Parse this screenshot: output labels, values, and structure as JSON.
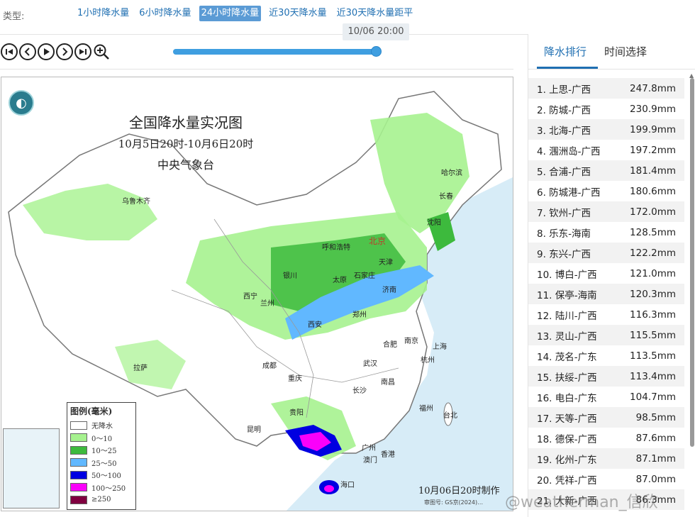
{
  "type_bar": {
    "label": "类型:",
    "tabs": [
      {
        "label": "1小时降水量",
        "active": false
      },
      {
        "label": "6小时降水量",
        "active": false
      },
      {
        "label": "24小时降水量",
        "active": true
      },
      {
        "label": "近30天降水量",
        "active": false
      },
      {
        "label": "近30天降水量距平",
        "active": false
      }
    ]
  },
  "player": {
    "time_tip": "10/06 20:00",
    "progress": 0.99,
    "buttons": [
      "first-icon",
      "prev-icon",
      "play-icon",
      "next-icon",
      "last-icon",
      "zoom-in-icon"
    ]
  },
  "map": {
    "title": "全国降水量实况图",
    "period": "10月5日20时-10月6日20时",
    "agency": "中央气象台",
    "make_note": "10月06日20时制作",
    "review_no": "审图号: GS京(2024)…",
    "watermark": "@weatherman_信欣",
    "cities": {
      "urumqi": "乌鲁木齐",
      "harbin": "哈尔滨",
      "changchun": "长春",
      "shenyang": "沈阳",
      "beijing": "北京",
      "tianjin": "天津",
      "hohhot": "呼和浩特",
      "shijiazhuang": "石家庄",
      "taiyuan": "太原",
      "jinan": "济南",
      "yinchuan": "银川",
      "xining": "西宁",
      "lanzhou": "兰州",
      "zhengzhou": "郑州",
      "xian": "西安",
      "hefei": "合肥",
      "nanjing": "南京",
      "shanghai": "上海",
      "hangzhou": "杭州",
      "wuhan": "武汉",
      "chengdu": "成都",
      "chongqing": "重庆",
      "lhasa": "拉萨",
      "changsha": "长沙",
      "nanchang": "南昌",
      "fuzhou": "福州",
      "taipei": "台北",
      "guiyang": "贵阳",
      "kunming": "昆明",
      "guangzhou": "广州",
      "hongkong": "香港",
      "macau": "澳门",
      "haikou": "海口"
    },
    "legend": {
      "title": "图例(毫米)",
      "items": [
        {
          "label": "无降水",
          "color": "#ffffff"
        },
        {
          "label": "0～10",
          "color": "#a6f28f"
        },
        {
          "label": "10～25",
          "color": "#3dba3d"
        },
        {
          "label": "25～50",
          "color": "#61b8ff"
        },
        {
          "label": "50～100",
          "color": "#0000e1"
        },
        {
          "label": "100～250",
          "color": "#fa00fa"
        },
        {
          "label": "≥250",
          "color": "#800040"
        }
      ]
    }
  },
  "side": {
    "tabs": [
      {
        "label": "降水排行",
        "active": true
      },
      {
        "label": "时间选择",
        "active": false
      }
    ],
    "ranking": [
      {
        "name": "1. 上思-广西",
        "value": "247.8mm"
      },
      {
        "name": "2. 防城-广西",
        "value": "230.9mm"
      },
      {
        "name": "3. 北海-广西",
        "value": "199.9mm"
      },
      {
        "name": "4. 涠洲岛-广西",
        "value": "197.2mm"
      },
      {
        "name": "5. 合浦-广西",
        "value": "181.4mm"
      },
      {
        "name": "6. 防城港-广西",
        "value": "180.6mm"
      },
      {
        "name": "7. 钦州-广西",
        "value": "172.0mm"
      },
      {
        "name": "8. 乐东-海南",
        "value": "128.5mm"
      },
      {
        "name": "9. 东兴-广西",
        "value": "122.2mm"
      },
      {
        "name": "10. 博白-广西",
        "value": "121.0mm"
      },
      {
        "name": "11. 保亭-海南",
        "value": "120.3mm"
      },
      {
        "name": "12. 陆川-广西",
        "value": "116.3mm"
      },
      {
        "name": "13. 灵山-广西",
        "value": "115.5mm"
      },
      {
        "name": "14. 茂名-广东",
        "value": "113.5mm"
      },
      {
        "name": "15. 扶绥-广西",
        "value": "113.4mm"
      },
      {
        "name": "16. 电白-广东",
        "value": "104.7mm"
      },
      {
        "name": "17. 天等-广西",
        "value": "98.5mm"
      },
      {
        "name": "18. 德保-广西",
        "value": "87.6mm"
      },
      {
        "name": "19. 化州-广东",
        "value": "87.1mm"
      },
      {
        "name": "20. 凭祥-广西",
        "value": "87.0mm"
      },
      {
        "name": "21. 大新-广西",
        "value": "86.3mm"
      }
    ]
  }
}
